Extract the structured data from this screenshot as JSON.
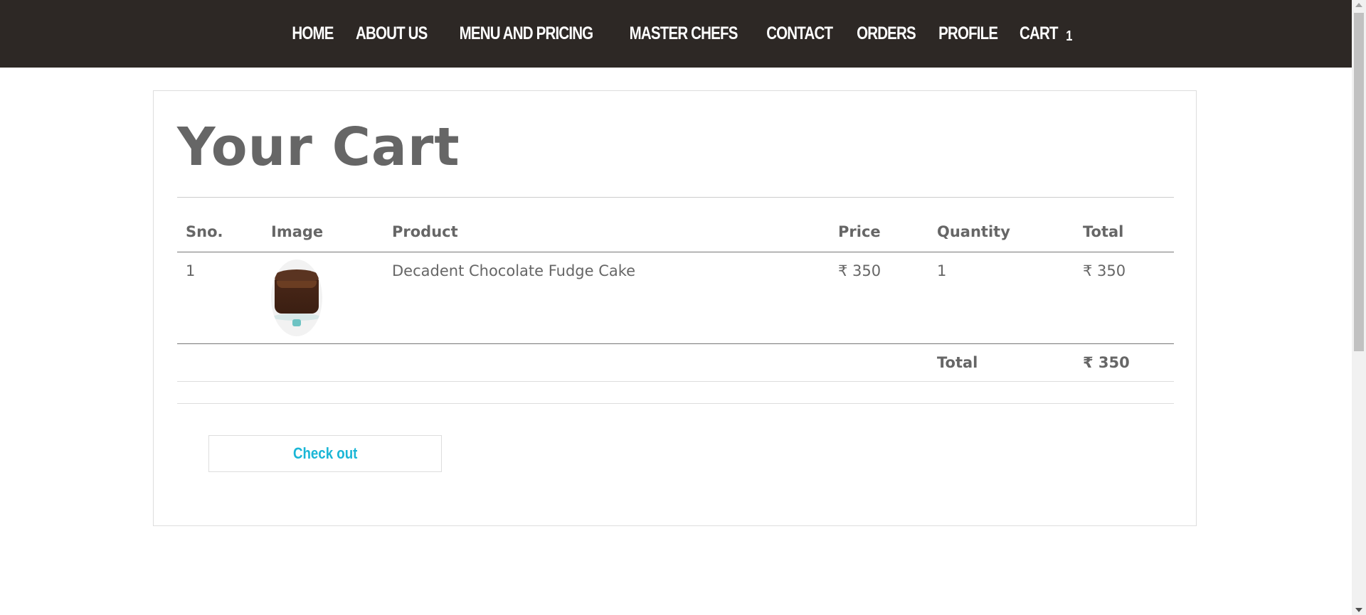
{
  "nav": {
    "items": [
      {
        "label": "HOME"
      },
      {
        "label": "ABOUT US"
      },
      {
        "label": "MENU AND PRICING"
      },
      {
        "label": "MASTER CHEFS"
      },
      {
        "label": "CONTACT"
      },
      {
        "label": "ORDERS"
      },
      {
        "label": "PROFILE"
      }
    ],
    "cart_label": "CART",
    "cart_count": "1"
  },
  "page": {
    "title": "Your Cart"
  },
  "table": {
    "headers": {
      "sno": "Sno.",
      "image": "Image",
      "product": "Product",
      "price": "Price",
      "quantity": "Quantity",
      "total": "Total"
    },
    "rows": [
      {
        "sno": "1",
        "image_icon": "chocolate-cake-image",
        "product": "Decadent Chocolate Fudge Cake",
        "price": "₹ 350",
        "quantity": "1",
        "total": "₹ 350"
      }
    ],
    "total_label": "Total",
    "total_value": "₹ 350"
  },
  "actions": {
    "checkout_label": "Check out"
  },
  "colors": {
    "navbar_bg": "#2d2825",
    "text": "#666666",
    "accent": "#1ab6d6"
  }
}
